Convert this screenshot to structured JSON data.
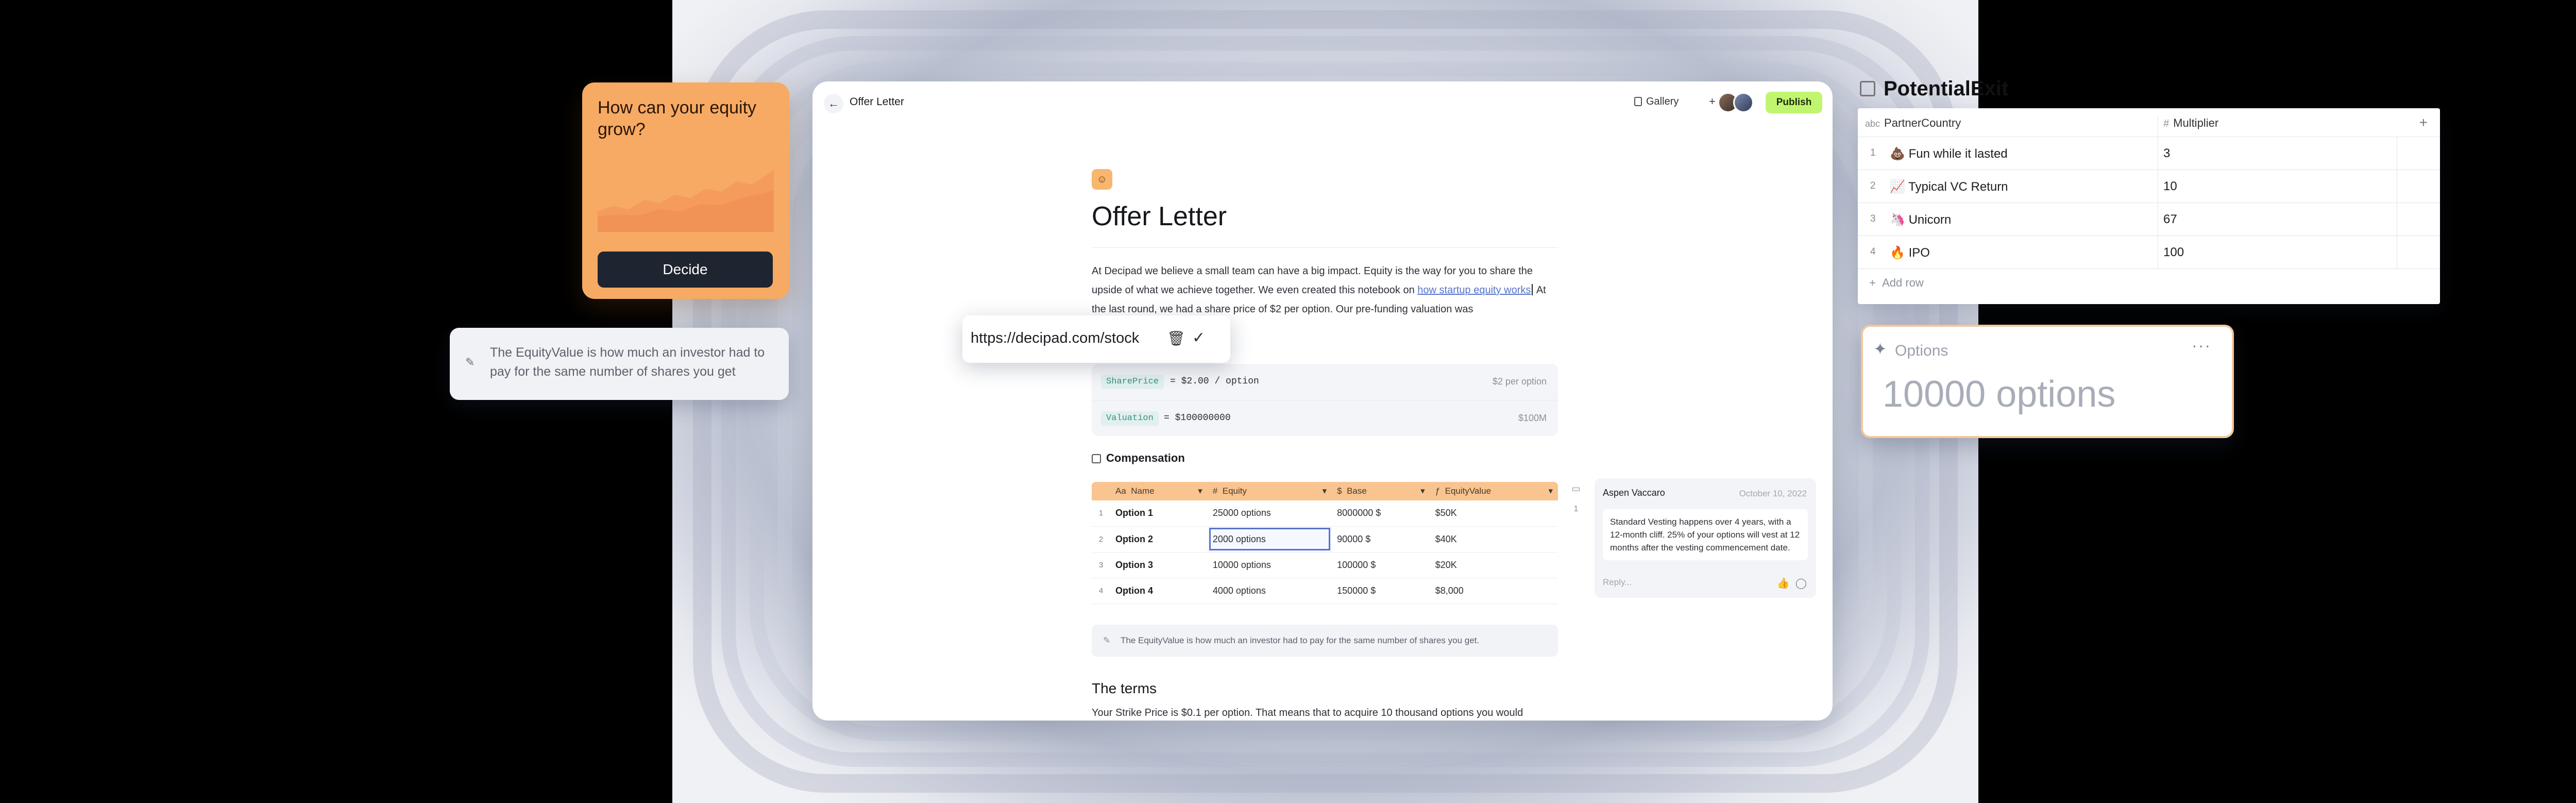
{
  "window": {
    "title": "Offer Letter",
    "gallery_label": "Gallery",
    "plus": "+",
    "publish_label": "Publish"
  },
  "doc": {
    "heading": "Offer Letter",
    "para_1": "At Decipad we believe a small team can have a big impact.   Equity is the way for you to share the upside of what we achieve together. We even created this notebook on ",
    "para_link": "how startup equity works",
    "para_2": " At the last round, we had a share price of $2 per option. Our pre-funding valuation was",
    "vars": [
      {
        "name": "SharePrice",
        "expr": "= $2.00 / option",
        "result": "$2 per option"
      },
      {
        "name": "Valuation",
        "expr": "= $100000000",
        "result": "$100M"
      }
    ],
    "section_title": "Compensation",
    "table": {
      "headers": [
        "Name",
        "Equity",
        "Base",
        "EquityValue"
      ],
      "header_types": [
        "Aa",
        "#",
        "$",
        "ƒ"
      ],
      "rows": [
        {
          "num": "1",
          "name": "Option 1",
          "equity": "25000 options",
          "base": "8000000 $",
          "value": "$50K"
        },
        {
          "num": "2",
          "name": "Option 2",
          "equity": "2000 options",
          "base": "90000 $",
          "value": "$40K"
        },
        {
          "num": "3",
          "name": "Option 3",
          "equity": "10000 options",
          "base": "100000 $",
          "value": "$20K"
        },
        {
          "num": "4",
          "name": "Option 4",
          "equity": "4000 options",
          "base": "150000 $",
          "value": "$8,000"
        }
      ]
    },
    "note": "The EquityValue is how much an investor had to pay for the same number of shares you get.",
    "terms_heading": "The terms",
    "terms_text": "Your  Strike Price is $0.1 per option. That means that to acquire 10 thousand options you would"
  },
  "comment": {
    "count": "1",
    "author": "Aspen Vaccaro",
    "date": "October 10, 2022",
    "body": "Standard Vesting happens over 4 years, with a 12-month cliff. 25% of your options will vest at 12 months after the vesting commencement date.",
    "reply_placeholder": "Reply..."
  },
  "url_popup": {
    "url": "https://decipad.com/stock"
  },
  "equity_card": {
    "title": "How can your equity grow?",
    "button": "Decide"
  },
  "tip": {
    "text": "The EquityValue is how much an investor had to pay for the same number of shares you get"
  },
  "potential": {
    "title": "PotentialExit",
    "col1_type": "abc",
    "col1": "PartnerCountry",
    "col2_type": "#",
    "col2": "Multiplier",
    "add_col": "+",
    "rows": [
      {
        "num": "1",
        "emoji": "💩",
        "name": "Fun while it lasted",
        "mult": "3"
      },
      {
        "num": "2",
        "emoji": "📈",
        "name": "Typical VC Return",
        "mult": "10"
      },
      {
        "num": "3",
        "emoji": "🦄",
        "name": "Unicorn",
        "mult": "67"
      },
      {
        "num": "4",
        "emoji": "🔥",
        "name": "IPO",
        "mult": "100"
      }
    ],
    "add_row": "Add row"
  },
  "options_card": {
    "label": "Options",
    "value": "10000 options"
  },
  "colors": {
    "accent_green": "#c1f56f",
    "table_header": "#f9c490",
    "equity_card": "#f7aa63",
    "link": "#5774c9"
  }
}
